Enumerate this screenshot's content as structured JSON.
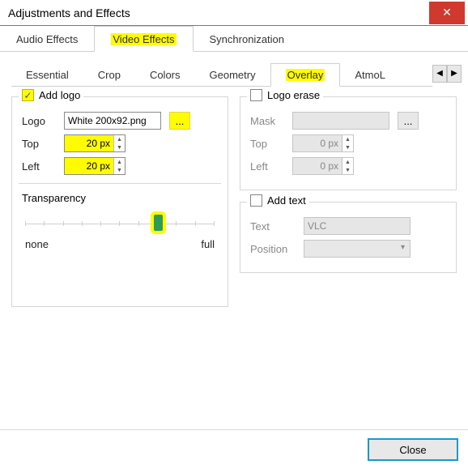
{
  "title": "Adjustments and Effects",
  "mainTabs": {
    "audio": "Audio Effects",
    "video": "Video Effects",
    "sync": "Synchronization"
  },
  "subTabs": {
    "essential": "Essential",
    "crop": "Crop",
    "colors": "Colors",
    "geometry": "Geometry",
    "overlay": "Overlay",
    "atmo": "AtmoL"
  },
  "addLogo": {
    "title": "Add logo",
    "logoLabel": "Logo",
    "logoValue": "White 200x92.png",
    "browse": "...",
    "topLabel": "Top",
    "topValue": "20 px",
    "leftLabel": "Left",
    "leftValue": "20 px",
    "transparency": "Transparency",
    "none": "none",
    "full": "full"
  },
  "logoErase": {
    "title": "Logo erase",
    "maskLabel": "Mask",
    "browse": "...",
    "topLabel": "Top",
    "topValue": "0 px",
    "leftLabel": "Left",
    "leftValue": "0 px"
  },
  "addText": {
    "title": "Add text",
    "textLabel": "Text",
    "textValue": "VLC",
    "positionLabel": "Position"
  },
  "closeBtn": "Close"
}
